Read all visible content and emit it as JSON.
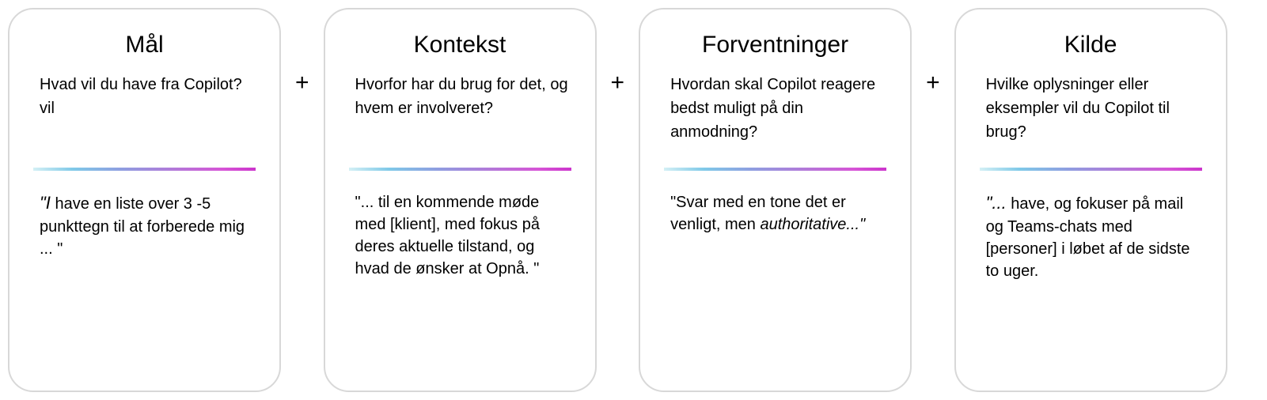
{
  "plus": "+",
  "cards": [
    {
      "title": "Mål",
      "question": "Hvad vil du have fra Copilot? vil",
      "example_html": "<span class=\"quote-open\">\"I</span> have en liste over 3 -5 punkttegn til at forberede mig ... \""
    },
    {
      "title": "Kontekst",
      "question": "Hvorfor har du brug for det, og hvem er involveret?",
      "example_html": "\"... til en kommende møde med [klient], med fokus på deres aktuelle tilstand, og hvad de ønsker at Opnå. \""
    },
    {
      "title": "Forventninger",
      "question": "Hvordan skal Copilot reagere bedst muligt på din anmodning?",
      "example_html": "\"Svar med en tone det er venligt, men <span class=\"italic\">authoritative...\"</span>"
    },
    {
      "title": "Kilde",
      "question": "Hvilke oplysninger eller eksempler vil du Copilot til brug?",
      "example_html": "<span class=\"first-word\">\"...</span> have, og fokuser på mail og Teams-chats med [personer] i løbet af de sidste to uger."
    }
  ]
}
